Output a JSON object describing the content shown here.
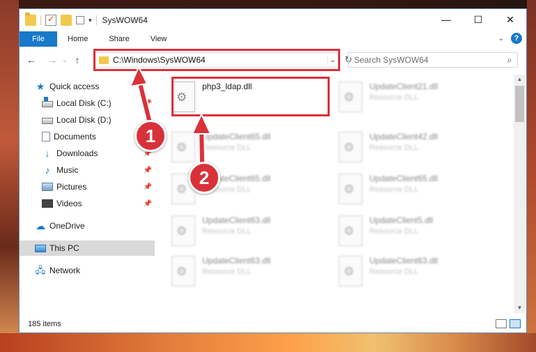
{
  "window": {
    "title": "SysWOW64",
    "controls": {
      "minimize": "—",
      "maximize": "☐",
      "close": "✕"
    }
  },
  "ribbon": {
    "tabs": [
      "File",
      "Home",
      "Share",
      "View"
    ]
  },
  "navbar": {
    "back": "←",
    "forward": "→",
    "recent": "⌄",
    "up": "↑",
    "address": "C:\\Windows\\SysWOW64",
    "search_placeholder": "Search SysWOW64"
  },
  "sidebar": {
    "items": [
      {
        "label": "Quick access",
        "icon": "star-icon"
      },
      {
        "label": "Local Disk (C:)",
        "icon": "disk-icon",
        "pinned": true
      },
      {
        "label": "Local Disk (D:)",
        "icon": "disk-icon",
        "pinned": true
      },
      {
        "label": "Documents",
        "icon": "documents-icon",
        "pinned": true
      },
      {
        "label": "Downloads",
        "icon": "download-icon",
        "pinned": true
      },
      {
        "label": "Music",
        "icon": "music-icon",
        "pinned": true
      },
      {
        "label": "Pictures",
        "icon": "pictures-icon",
        "pinned": true
      },
      {
        "label": "Videos",
        "icon": "videos-icon",
        "pinned": true
      },
      {
        "label": "OneDrive",
        "icon": "cloud-icon"
      },
      {
        "label": "This PC",
        "icon": "computer-icon",
        "selected": true
      },
      {
        "label": "Network",
        "icon": "network-icon"
      }
    ]
  },
  "files": [
    {
      "name": "php3_ldap.dll",
      "type": ""
    },
    {
      "name": "UpdateClient21.dll",
      "type": "Resource DLL"
    },
    {
      "name": "UpdateClient65.dll",
      "type": "Resource DLL"
    },
    {
      "name": "UpdateClient42.dll",
      "type": "Resource DLL"
    },
    {
      "name": "UpdateClient65.dll",
      "type": "Resource DLL"
    },
    {
      "name": "UpdateClient65.dll",
      "type": "Resource DLL"
    },
    {
      "name": "UpdateClient63.dll",
      "type": "Resource DLL"
    },
    {
      "name": "UpdateClient5.dll",
      "type": "Resource DLL"
    },
    {
      "name": "UpdateClient63.dll",
      "type": "Resource DLL"
    },
    {
      "name": "UpdateClient63.dll",
      "type": "Resource DLL"
    }
  ],
  "status": {
    "item_count": "185 items"
  },
  "annotations": {
    "step1": "1",
    "step2": "2",
    "color": "#d9313a"
  }
}
